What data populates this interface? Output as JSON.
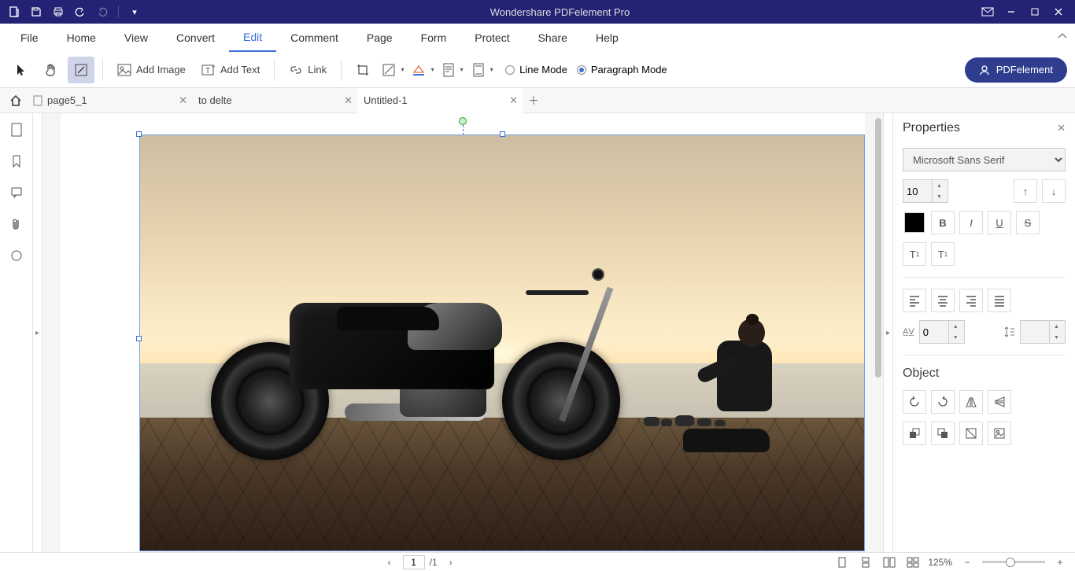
{
  "app": {
    "title": "Wondershare PDFelement Pro"
  },
  "menu": {
    "items": [
      "File",
      "Home",
      "View",
      "Convert",
      "Edit",
      "Comment",
      "Page",
      "Form",
      "Protect",
      "Share",
      "Help"
    ],
    "active": "Edit"
  },
  "toolbar": {
    "add_image": "Add Image",
    "add_text": "Add Text",
    "link": "Link",
    "line_mode": "Line Mode",
    "paragraph_mode": "Paragraph Mode",
    "brand": "PDFelement"
  },
  "tabs": [
    {
      "label": "page5_1",
      "active": false
    },
    {
      "label": "to delte",
      "active": false
    },
    {
      "label": "Untitled-1",
      "active": true
    }
  ],
  "properties": {
    "title": "Properties",
    "font_family": "Microsoft Sans Serif",
    "font_size": "10",
    "char_spacing": "0",
    "object_title": "Object"
  },
  "status": {
    "page_current": "1",
    "page_total": "1",
    "zoom": "125%"
  }
}
